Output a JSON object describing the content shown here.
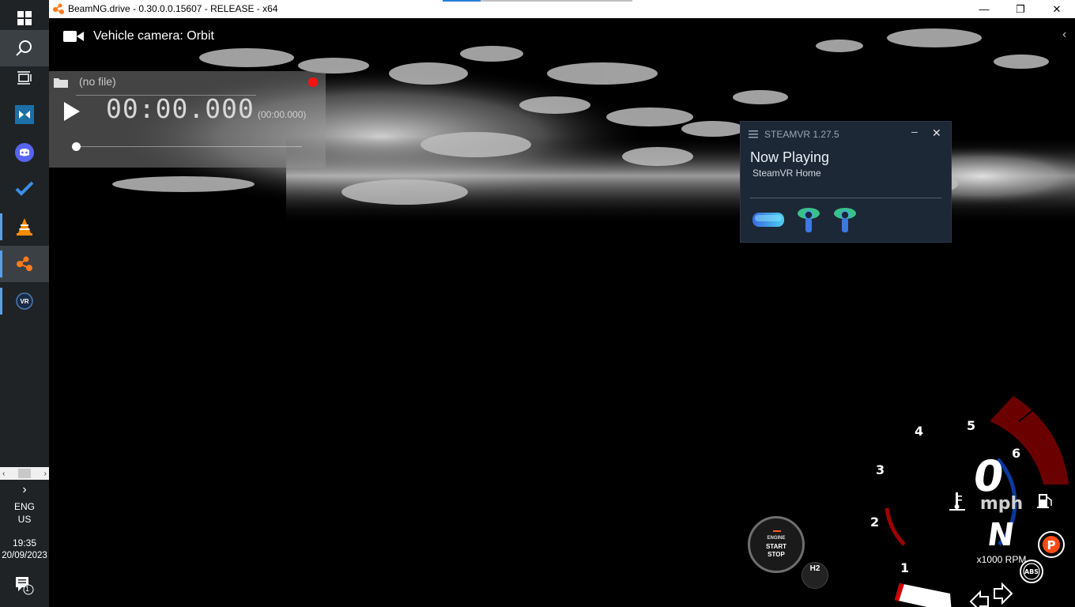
{
  "window": {
    "title": "BeamNG.drive - 0.30.0.0.15607 - RELEASE - x64",
    "minimize_glyph": "—",
    "maximize_glyph": "❐",
    "close_glyph": "✕"
  },
  "taskbar": {
    "apps": [
      {
        "name": "windows-start-icon"
      },
      {
        "name": "search-icon"
      },
      {
        "name": "task-view-icon"
      },
      {
        "name": "dolby-access-icon"
      },
      {
        "name": "discord-icon"
      },
      {
        "name": "microsoft-todo-icon"
      },
      {
        "name": "vlc-icon"
      },
      {
        "name": "beamng-icon"
      },
      {
        "name": "steamvr-icon"
      }
    ],
    "chevron": "›",
    "language_line1": "ENG",
    "language_line2": "US",
    "time": "19:35",
    "date": "20/09/2023",
    "notifications_count": "1"
  },
  "game": {
    "camera_label": "Vehicle camera: Orbit",
    "replay": {
      "file": "(no file)",
      "time": "00:00.000",
      "duration": "(00:00.000)"
    },
    "steamvr": {
      "version": "STEAMVR 1.27.5",
      "now_playing": "Now Playing",
      "now_playing_app": "SteamVR Home",
      "minimize": "–",
      "close": "✕"
    },
    "dashboard": {
      "speed": "0",
      "speed_unit": "mph",
      "gear": "N",
      "rpm_unit": "x1000 RPM",
      "rpm_ticks": [
        "1",
        "2",
        "3",
        "4",
        "5",
        "6"
      ],
      "engine_label_top": "ENGINE",
      "engine_label_1": "START",
      "engine_label_2": "STOP",
      "h2_label": "H2",
      "parking_label": "P",
      "abs_label": "ABS",
      "colors": {
        "redline": "#6b0000",
        "fuel_arc": "#0a3aa0",
        "temp_arc": "#a00000",
        "parking": "#ff4a12"
      }
    }
  }
}
